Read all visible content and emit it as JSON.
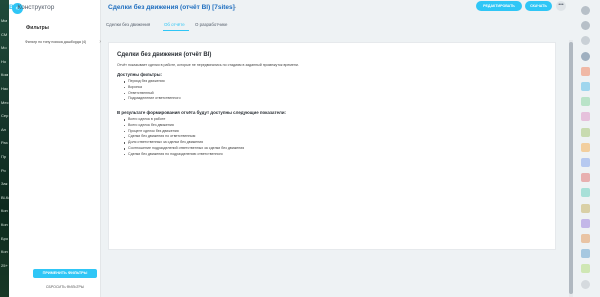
{
  "brand": {
    "prefix": "BI",
    "name": "Конструктор"
  },
  "header": {
    "title": "Сделки без движения (отчёт BI) [7sites]",
    "edit_label": "РЕДАКТИРОВАТЬ",
    "share_label": "СКАЧАТЬ",
    "more_label": "•••"
  },
  "tabs": [
    {
      "label": "Сделки без движения",
      "active": false
    },
    {
      "label": "Об отчёте",
      "active": true
    },
    {
      "label": "О разработчике",
      "active": false
    }
  ],
  "left_strip": [
    "Мм",
    "СМ",
    "Мо",
    "Но",
    "Ком",
    "Нас",
    "Мес",
    "Сер",
    "Ан",
    "Раз",
    "Пр",
    "Ро",
    "Зак",
    "Bl-Ко",
    "Кон",
    "Кон",
    "Бро",
    "Кон",
    "25+"
  ],
  "filters": {
    "title": "Фильтры",
    "row_label": "Фильтр по типу поиска дашборда (4)",
    "apply_label": "ПРИМЕНИТЬ ФИЛЬТРЫ",
    "reset_label": "СБРОСИТЬ ФИЛЬТРЫ"
  },
  "report": {
    "title": "Сделки без движения (отчёт BI)",
    "description": "Отчёт показывает сделки в работе, которые не передвигались по стадиям в заданный промежуток времени.",
    "filters_heading": "Доступны фильтры:",
    "filters": [
      "Период без движения",
      "Воронка",
      "Ответственный",
      "Подразделение ответственного"
    ],
    "metrics_heading": "В результате формирования отчёта будут доступны следующие показатели:",
    "metrics": [
      "Всего сделок в работе",
      "Всего сделок без движения",
      "Процент сделок без движения",
      "Сделки без движения по ответственным",
      "Доля ответственных за сделки без движения",
      "Соотношение подразделений ответственных за сделки без движения",
      "Сделки без движения по подразделению ответственного"
    ]
  },
  "colors": {
    "accent": "#2fc6f6",
    "title_blue": "#1e6ebf"
  }
}
